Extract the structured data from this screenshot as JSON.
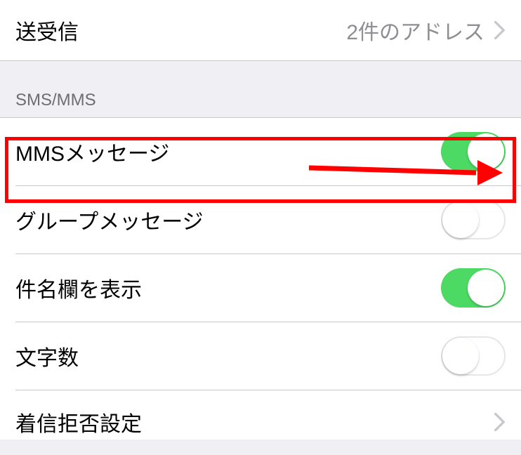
{
  "top_row": {
    "label": "送受信",
    "value": "2件のアドレス"
  },
  "sms_section": {
    "header": "SMS/MMS",
    "rows": [
      {
        "label": "MMSメッセージ",
        "toggle": "on",
        "highlighted": true
      },
      {
        "label": "グループメッセージ",
        "toggle": "off"
      },
      {
        "label": "件名欄を表示",
        "toggle": "on"
      },
      {
        "label": "文字数",
        "toggle": "off"
      },
      {
        "label": "着信拒否設定",
        "chevron": true
      }
    ]
  },
  "colors": {
    "toggle_on": "#4cd964",
    "highlight": "#ff0000"
  }
}
